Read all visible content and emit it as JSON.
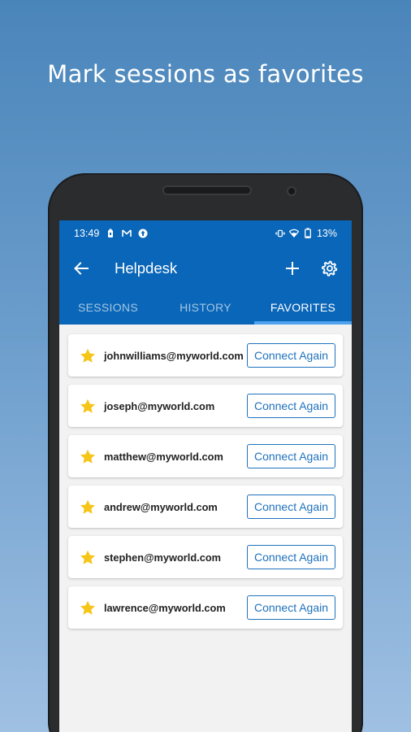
{
  "headline": "Mark sessions as favorites",
  "status_bar": {
    "time": "13:49",
    "battery": "13%",
    "icons": [
      "battery-saver-icon",
      "gmail-icon",
      "vpn-icon",
      "vibrate-icon",
      "wifi-icon",
      "battery-icon"
    ]
  },
  "app_bar": {
    "title": "Helpdesk",
    "icons": [
      "back-arrow-icon",
      "add-icon",
      "settings-icon"
    ]
  },
  "tabs": [
    {
      "label": "SESSIONS",
      "active": false
    },
    {
      "label": "HISTORY",
      "active": false
    },
    {
      "label": "FAVORITES",
      "active": true
    }
  ],
  "favorites": [
    {
      "email": "johnwilliams@myworld.com",
      "action": "Connect Again"
    },
    {
      "email": "joseph@myworld.com",
      "action": "Connect Again"
    },
    {
      "email": "matthew@myworld.com",
      "action": "Connect Again"
    },
    {
      "email": "andrew@myworld.com",
      "action": "Connect Again"
    },
    {
      "email": "stephen@myworld.com",
      "action": "Connect Again"
    },
    {
      "email": "lawrence@myworld.com",
      "action": "Connect Again"
    }
  ],
  "colors": {
    "primary": "#0a66b8",
    "tab_indicator": "#4fa3ee",
    "star": "#f5c518",
    "button_outline": "#1f72bd"
  }
}
